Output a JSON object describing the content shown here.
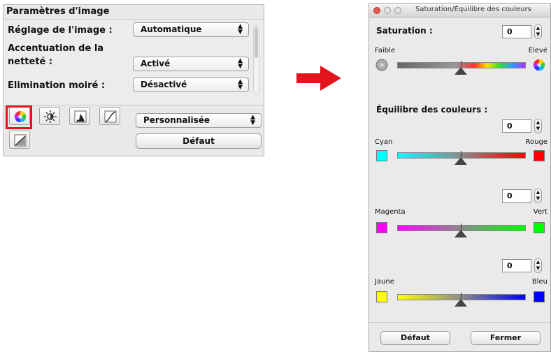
{
  "left_panel": {
    "title": "Paramètres d'image",
    "rows": [
      {
        "label": "Réglage de l'image :",
        "value": "Automatique"
      },
      {
        "label_line1": "Accentuation de la",
        "label_line2": "netteté :",
        "value": "Activé"
      },
      {
        "label": "Elimination moiré :",
        "value": "Désactivé"
      }
    ],
    "tone_select": {
      "value": "Personnalisée"
    },
    "default_button": "Défaut",
    "tools": [
      "saturation-balance-icon",
      "brightness-contrast-icon",
      "histogram-icon",
      "tone-curve-icon",
      "threshold-icon"
    ]
  },
  "dialog": {
    "title": "Saturation/Équilibre des couleurs",
    "saturation": {
      "label": "Saturation :",
      "value": "0",
      "low_label": "Faible",
      "high_label": "Elevé"
    },
    "balance_label": "Équilibre des couleurs :",
    "balances": [
      {
        "value": "0",
        "left_label": "Cyan",
        "right_label": "Rouge",
        "left_color": "#00ffff",
        "right_color": "#ff0000"
      },
      {
        "value": "0",
        "left_label": "Magenta",
        "right_label": "Vert",
        "left_color": "#ff00ff",
        "right_color": "#00ff00"
      },
      {
        "value": "0",
        "left_label": "Jaune",
        "right_label": "Bleu",
        "left_color": "#ffff00",
        "right_color": "#0000ff"
      }
    ],
    "default_button": "Défaut",
    "close_button": "Fermer"
  },
  "colors": {
    "highlight": "#e3141b",
    "arrow": "#e3141b"
  }
}
